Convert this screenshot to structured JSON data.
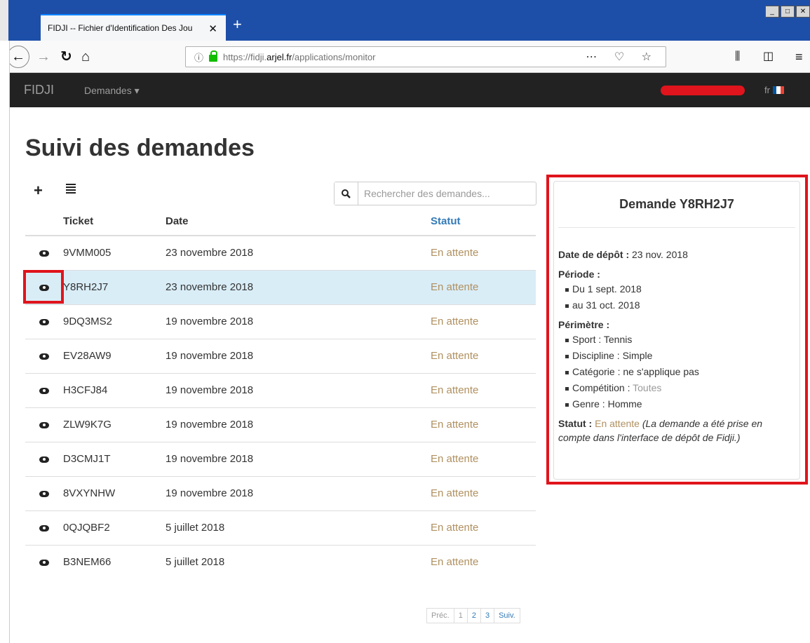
{
  "browser": {
    "tab_title": "FIDJI -- Fichier d'Identification Des Jou",
    "url_scheme": "https://fidji.",
    "url_domain": "arjel.fr",
    "url_path": "/applications/monitor"
  },
  "app": {
    "brand": "FIDJI",
    "menu_demandes": "Demandes ▾",
    "lang": "fr",
    "flag_colors": [
      "#0055a4",
      "#ffffff",
      "#ef4135"
    ]
  },
  "page": {
    "title": "Suivi des demandes",
    "search_placeholder": "Rechercher des demandes..."
  },
  "table": {
    "headers": {
      "ticket": "Ticket",
      "date": "Date",
      "statut": "Statut"
    },
    "rows": [
      {
        "ticket": "9VMM005",
        "date": "23 novembre 2018",
        "statut": "En attente"
      },
      {
        "ticket": "Y8RH2J7",
        "date": "23 novembre 2018",
        "statut": "En attente"
      },
      {
        "ticket": "9DQ3MS2",
        "date": "19 novembre 2018",
        "statut": "En attente"
      },
      {
        "ticket": "EV28AW9",
        "date": "19 novembre 2018",
        "statut": "En attente"
      },
      {
        "ticket": "H3CFJ84",
        "date": "19 novembre 2018",
        "statut": "En attente"
      },
      {
        "ticket": "ZLW9K7G",
        "date": "19 novembre 2018",
        "statut": "En attente"
      },
      {
        "ticket": "D3CMJ1T",
        "date": "19 novembre 2018",
        "statut": "En attente"
      },
      {
        "ticket": "8VXYNHW",
        "date": "19 novembre 2018",
        "statut": "En attente"
      },
      {
        "ticket": "0QJQBF2",
        "date": "5 juillet 2018",
        "statut": "En attente"
      },
      {
        "ticket": "B3NEM66",
        "date": "5 juillet 2018",
        "statut": "En attente"
      }
    ]
  },
  "pagination": {
    "prev": "Préc.",
    "pages": [
      "1",
      "2",
      "3"
    ],
    "next": "Suiv."
  },
  "detail": {
    "title": "Demande Y8RH2J7",
    "date_label": "Date de dépôt :",
    "date_value": "23 nov. 2018",
    "periode_label": "Période :",
    "periode_from": "Du 1 sept. 2018",
    "periode_to": "au 31 oct. 2018",
    "perimetre_label": "Périmètre :",
    "sport": "Sport : Tennis",
    "discipline": "Discipline : Simple",
    "categorie": "Catégorie : ne s'applique pas",
    "competition_label": "Compétition : ",
    "competition_value": "Toutes",
    "genre": "Genre : Homme",
    "statut_label": "Statut :",
    "statut_value": "En attente",
    "statut_note": "(La demande a été prise en compte dans l'interface de dépôt de Fidji.)"
  }
}
